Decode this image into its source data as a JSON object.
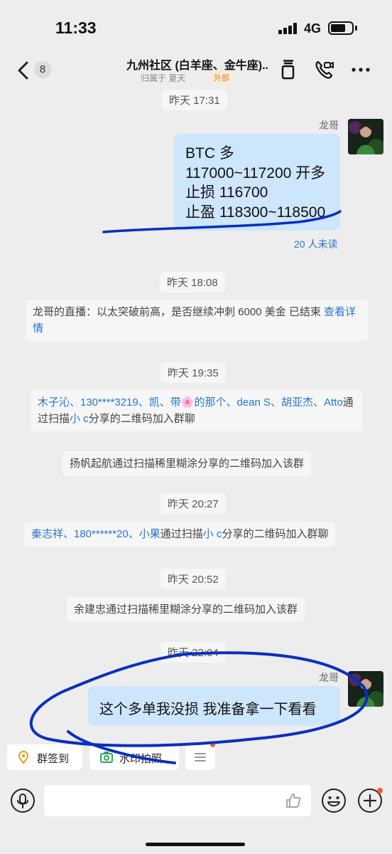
{
  "status_bar": {
    "time": "11:33",
    "network": "4G",
    "battery_level": 0.7
  },
  "header": {
    "unread_count": "8",
    "title": "九州社区 (白羊座、金牛座)...",
    "subtitle": "归属于 夏天",
    "tag": "外部"
  },
  "messages": {
    "ts1": "昨天 17:31",
    "msg1": {
      "sender": "龙哥",
      "lines": [
        "BTC 多",
        "117000~117200 开多",
        "止损 116700",
        "止盈 118300~118500"
      ],
      "read_status": "20 人未读"
    },
    "ts2": "昨天 18:08",
    "sys1": {
      "text": "龙哥的直播：以太突破前高，是否继续冲刺 6000 美金 已结束 ",
      "link": "查看详情"
    },
    "ts3": "昨天 19:35",
    "sys2": {
      "names1": "木子沁、130****3219、凯、带",
      "emoji": "🌸",
      "names2": "的那个、dean S、胡亚杰、Atto",
      "mid": "通过扫描",
      "sharer": "小 c",
      "tail": "分享的二维码加入群聊"
    },
    "sys3": "扬帆起航通过扫描稀里糊涂分享的二维码加入该群",
    "ts4": "昨天 20:27",
    "sys4": {
      "names": "秦志祥、180******20、小果",
      "mid": "通过扫描",
      "sharer": "小 c",
      "tail": "分享的二维码加入群聊"
    },
    "ts5": "昨天 20:52",
    "sys5": "余建忠通过扫描稀里糊涂分享的二维码加入该群",
    "ts6": "昨天 22:04",
    "msg2": {
      "sender": "龙哥",
      "text": "这个多单我没损 我准备拿一下看看"
    }
  },
  "quick_actions": [
    {
      "label": "群签到",
      "icon": "location-pin-icon"
    },
    {
      "label": "水印拍照",
      "icon": "camera-icon"
    },
    {
      "label": "",
      "icon": "menu-icon"
    }
  ],
  "colors": {
    "accent": "#2a76c9",
    "bubble": "#cde6fb",
    "annotation": "#0a2fc0",
    "badge": "#ff5a2a"
  }
}
